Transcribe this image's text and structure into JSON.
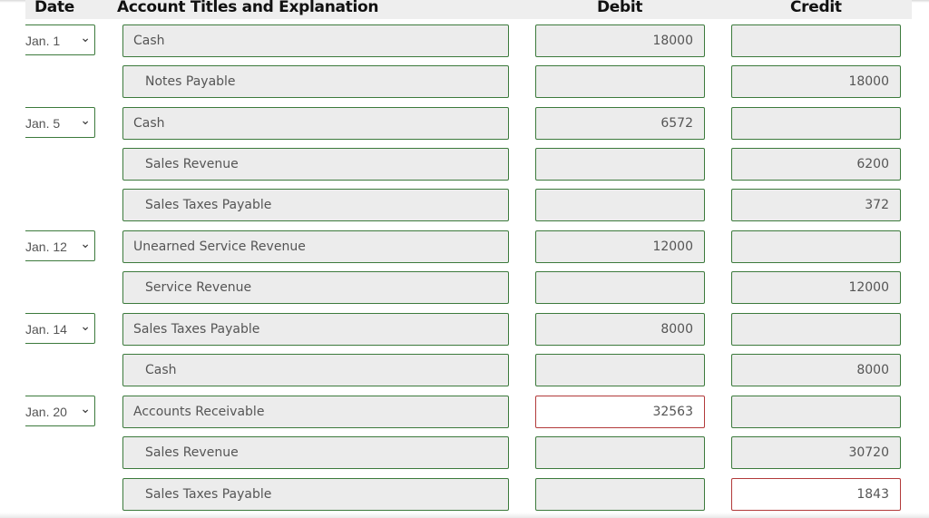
{
  "header": {
    "date": "Date",
    "account": "Account Titles and Explanation",
    "debit": "Debit",
    "credit": "Credit"
  },
  "rows": [
    {
      "date": "Jan. 1",
      "account": "Cash",
      "debit": "18000",
      "credit": ""
    },
    {
      "date": "",
      "account": "Notes Payable",
      "debit": "",
      "credit": "18000"
    },
    {
      "date": "Jan. 5",
      "account": "Cash",
      "debit": "6572",
      "credit": ""
    },
    {
      "date": "",
      "account": "Sales Revenue",
      "debit": "",
      "credit": "6200"
    },
    {
      "date": "",
      "account": "Sales Taxes Payable",
      "debit": "",
      "credit": "372"
    },
    {
      "date": "Jan. 12",
      "account": "Unearned Service Revenue",
      "debit": "12000",
      "credit": ""
    },
    {
      "date": "",
      "account": "Service Revenue",
      "debit": "",
      "credit": "12000"
    },
    {
      "date": "Jan. 14",
      "account": "Sales Taxes Payable",
      "debit": "8000",
      "credit": ""
    },
    {
      "date": "",
      "account": "Cash",
      "debit": "",
      "credit": "8000"
    },
    {
      "date": "Jan. 20",
      "account": "Accounts Receivable",
      "debit": "32563",
      "credit": "",
      "debit_status": "incorrect"
    },
    {
      "date": "",
      "account": "Sales Revenue",
      "debit": "",
      "credit": "30720"
    },
    {
      "date": "",
      "account": "Sales Taxes Payable",
      "debit": "",
      "credit": "1843",
      "credit_status": "incorrect"
    }
  ],
  "colors": {
    "correct_border": "#3c7a3c",
    "incorrect_border": "#b23a3a",
    "field_bg": "#ececec"
  },
  "icons": {
    "dropdown": "chevron-down-icon"
  }
}
